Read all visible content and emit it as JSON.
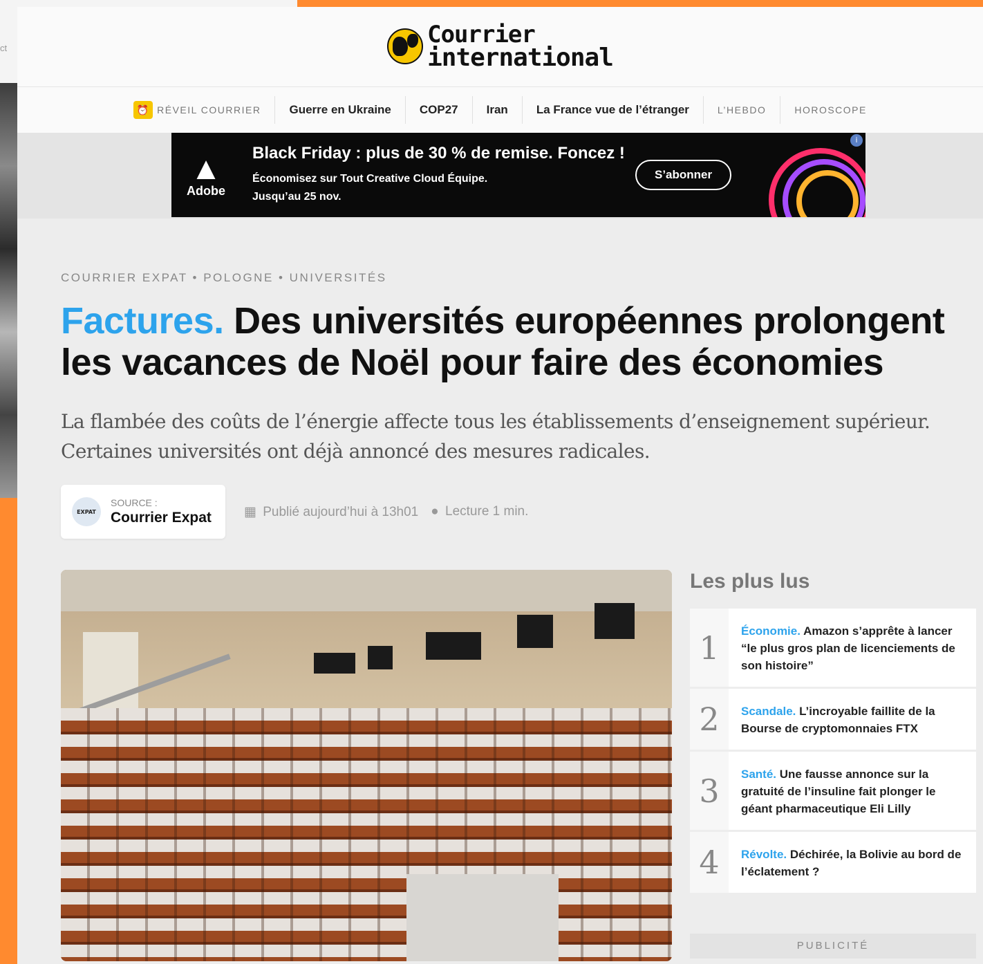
{
  "background_fragment": {
    "text": "ct"
  },
  "site": {
    "logo_line1": "Courrier",
    "logo_line2": "international"
  },
  "nav": {
    "items": [
      {
        "label": "RÉVEIL COURRIER",
        "style": "small",
        "icon": "alarm-clock-icon"
      },
      {
        "label": "Guerre en Ukraine"
      },
      {
        "label": "COP27"
      },
      {
        "label": "Iran"
      },
      {
        "label": "La France vue de l’étranger"
      },
      {
        "label": "L’HEBDO",
        "style": "small"
      },
      {
        "label": "HOROSCOPE",
        "style": "small"
      }
    ]
  },
  "ad": {
    "brand": "Adobe",
    "headline": "Black Friday : plus de 30 % de remise. Foncez !",
    "sub1": "Économisez sur Tout Creative Cloud Équipe.",
    "sub2": "Jusqu’au 25 nov.",
    "cta": "S’abonner"
  },
  "article": {
    "breadcrumb": "COURRIER EXPAT • POLOGNE • UNIVERSITÉS",
    "kicker": "Factures.",
    "title": "Des universités européennes prolongent les vacances de Noël pour faire des économies",
    "lede": "La flambée des coûts de l’énergie affecte tous les établissements d’enseignement supérieur. Certaines universités ont déjà annoncé des mesures radicales.",
    "source_label": "SOURCE :",
    "source_name": "Courrier Expat",
    "source_logo_text": "EXPAT",
    "published": "Publié aujourd’hui à 13h01",
    "reading": "Lecture 1 min."
  },
  "sidebar": {
    "title": "Les plus lus",
    "items": [
      {
        "num": "1",
        "cat": "Économie.",
        "text": "Amazon s’apprête à lancer “le plus gros plan de licenciements de son histoire”"
      },
      {
        "num": "2",
        "cat": "Scandale.",
        "text": "L’incroyable faillite de la Bourse de cryptomonnaies FTX"
      },
      {
        "num": "3",
        "cat": "Santé.",
        "text": "Une fausse annonce sur la gratuité de l’insuline fait plonger le géant pharmaceutique Eli Lilly"
      },
      {
        "num": "4",
        "cat": "Révolte.",
        "text": "Déchirée, la Bolivie au bord de l’éclatement ?"
      }
    ],
    "pub_label": "PUBLICITÉ"
  },
  "colors": {
    "accent": "#2da3ec",
    "frame": "#ff8a2f",
    "logo_yellow": "#f7c600"
  }
}
